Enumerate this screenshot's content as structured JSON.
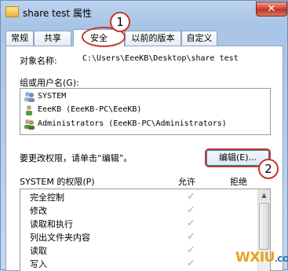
{
  "window": {
    "title": "share test 属性",
    "close_label": "✕"
  },
  "tabs": [
    {
      "label": "常规"
    },
    {
      "label": "共享"
    },
    {
      "label": "安全",
      "active": true
    },
    {
      "label": "以前的版本"
    },
    {
      "label": "自定义"
    }
  ],
  "security": {
    "object_name_label": "对象名称:",
    "object_name_value": "C:\\Users\\EeeKB\\Desktop\\share test",
    "group_label": "组或用户名(G):",
    "users": [
      {
        "name": "SYSTEM",
        "icon": "users-group-icon"
      },
      {
        "name": "EeeKB (EeeKB-PC\\EeeKB)",
        "icon": "user-icon"
      },
      {
        "name": "Administrators (EeeKB-PC\\Administrators)",
        "icon": "users-group-icon"
      }
    ],
    "edit_hint": "要更改权限，请单击“编辑”。",
    "edit_button": "编辑(E)...",
    "permissions_label": "SYSTEM 的权限(P)",
    "allow_label": "允许",
    "deny_label": "拒绝",
    "permissions": [
      {
        "name": "完全控制",
        "allow": true
      },
      {
        "name": "修改",
        "allow": true
      },
      {
        "name": "读取和执行",
        "allow": true
      },
      {
        "name": "列出文件夹内容",
        "allow": true
      },
      {
        "name": "读取",
        "allow": true
      },
      {
        "name": "写入",
        "allow": true
      }
    ]
  },
  "annotations": {
    "marker1": "1",
    "marker2": "2"
  },
  "watermark": {
    "text": "WXIU",
    "sub": ".COM"
  },
  "colors": {
    "annotation_red": "#c0392b",
    "checkmark_gray": "#aaaaaa"
  }
}
